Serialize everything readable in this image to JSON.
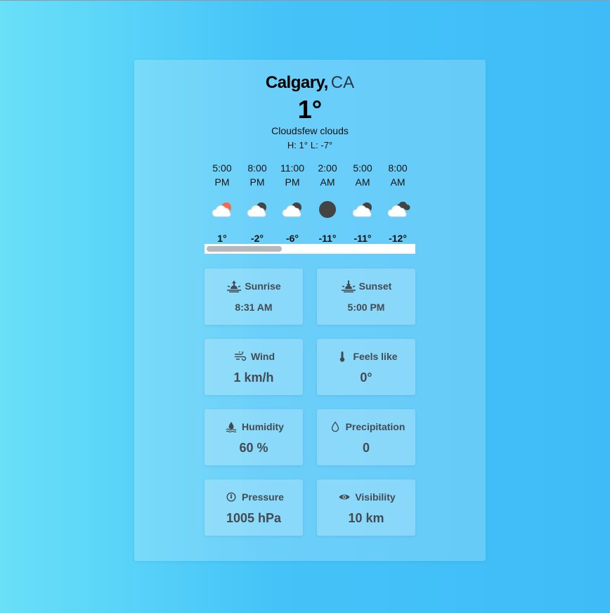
{
  "header": {
    "city": "Calgary,",
    "country": "CA",
    "temperature": "1°",
    "description": "Cloudsfew clouds",
    "high": "H: 1°",
    "low": "L: -7°"
  },
  "hourly": [
    {
      "time": "5:00 PM",
      "temp": "1°",
      "icon": "few-clouds-day-icon"
    },
    {
      "time": "8:00 PM",
      "temp": "-2°",
      "icon": "few-clouds-night-icon"
    },
    {
      "time": "11:00 PM",
      "temp": "-6°",
      "icon": "few-clouds-night-icon"
    },
    {
      "time": "2:00 AM",
      "temp": "-11°",
      "icon": "clear-night-icon"
    },
    {
      "time": "5:00 AM",
      "temp": "-11°",
      "icon": "few-clouds-night-icon"
    },
    {
      "time": "8:00 AM",
      "temp": "-12°",
      "icon": "broken-clouds-icon"
    }
  ],
  "details": {
    "sunrise": {
      "label": "Sunrise",
      "value": "8:31 AM",
      "icon": "sunrise-icon"
    },
    "sunset": {
      "label": "Sunset",
      "value": "5:00 PM",
      "icon": "sunset-icon"
    },
    "wind": {
      "label": "Wind",
      "value": "1 km/h",
      "icon": "wind-icon"
    },
    "feels_like": {
      "label": "Feels like",
      "value": "0°",
      "icon": "thermometer-icon"
    },
    "humidity": {
      "label": "Humidity",
      "value": "60 %",
      "icon": "humidity-icon"
    },
    "precipitation": {
      "label": "Precipitation",
      "value": "0",
      "icon": "droplet-icon"
    },
    "pressure": {
      "label": "Pressure",
      "value": "1005 hPa",
      "icon": "gauge-icon"
    },
    "visibility": {
      "label": "Visibility",
      "value": "10 km",
      "icon": "eye-icon"
    }
  },
  "colors": {
    "background_start": "#69e0f8",
    "background_end": "#3fbcf7",
    "sun": "#f26b4a",
    "moon": "#444444",
    "tile_text": "#434a52"
  }
}
